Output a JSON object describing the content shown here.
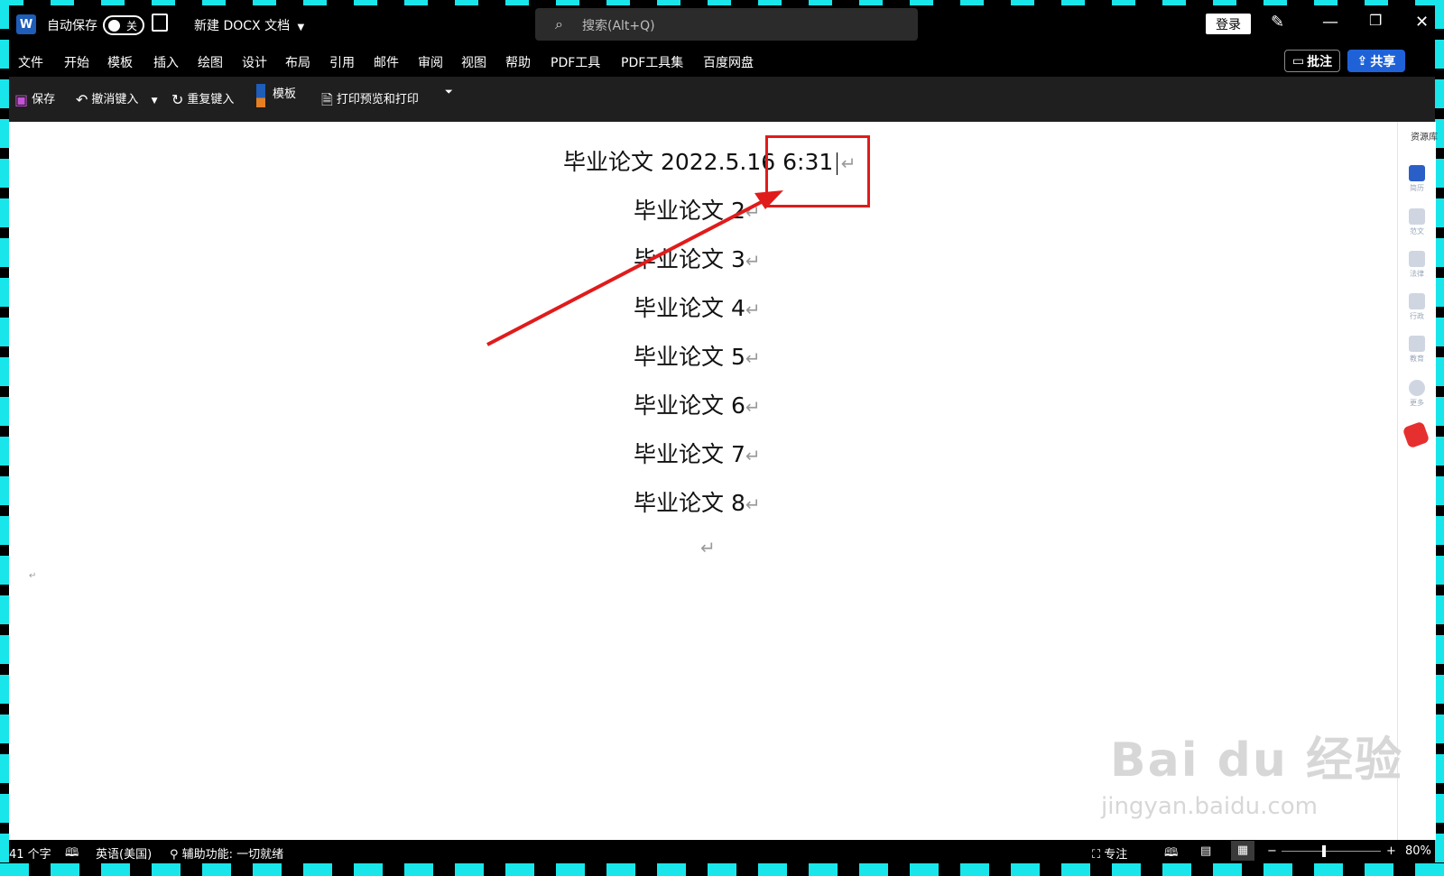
{
  "titlebar": {
    "app_icon_letter": "W",
    "autosave_label": "自动保存",
    "autosave_toggle": "关",
    "doc_title": "新建 DOCX 文档",
    "search_placeholder": "搜索(Alt+Q)",
    "login_label": "登录",
    "minimize": "—",
    "restore": "❐",
    "close": "✕"
  },
  "menu": {
    "items": [
      "文件",
      "开始",
      "模板",
      "插入",
      "绘图",
      "设计",
      "布局",
      "引用",
      "邮件",
      "审阅",
      "视图",
      "帮助",
      "PDF工具",
      "PDF工具集",
      "百度网盘"
    ],
    "comment_label": "批注",
    "share_label": "共享"
  },
  "ribbon": {
    "save": "保存",
    "undo": "撤消键入",
    "redo": "重复键入",
    "template": "模板",
    "print_preview": "打印预览和打印"
  },
  "document": {
    "lines": [
      "毕业论文 2022.5.16 6:31",
      "毕业论文 2",
      "毕业论文 3",
      "毕业论文 4",
      "毕业论文 5",
      "毕业论文 6",
      "毕业论文 7",
      "毕业论文 8"
    ],
    "paragraph_mark": "↵"
  },
  "sidepanel": {
    "title": "资源库",
    "items": [
      "简历",
      "范文",
      "法律",
      "行政",
      "教育",
      "更多"
    ]
  },
  "statusbar": {
    "word_count": "41 个字",
    "language": "英语(美国)",
    "accessibility": "辅助功能: 一切就绪",
    "focus": "专注",
    "zoom": "80%"
  },
  "watermark": {
    "brand": "Bai du 经验",
    "url": "jingyan.baidu.com"
  },
  "colors": {
    "frame": "#19e6ea",
    "annotation": "#e01b1b",
    "share": "#1f62d8"
  }
}
